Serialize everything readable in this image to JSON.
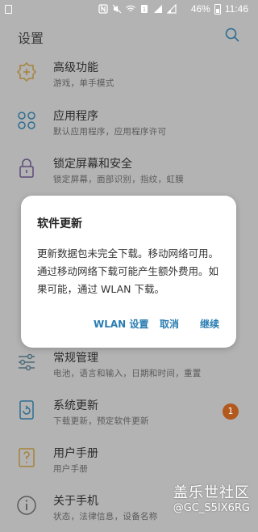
{
  "status_bar": {
    "battery_percent": "46%",
    "time": "11:46"
  },
  "header": {
    "title": "设置"
  },
  "settings_items": [
    {
      "title": "高级功能",
      "subtitle": "游戏，单手模式",
      "icon": "advanced-features-icon"
    },
    {
      "title": "应用程序",
      "subtitle": "默认应用程序，应用程序许可",
      "icon": "apps-icon"
    },
    {
      "title": "锁定屏幕和安全",
      "subtitle": "锁定屏幕，面部识别，指纹，虹膜",
      "icon": "lock-icon"
    },
    {
      "title": "常规管理",
      "subtitle": "电池，语言和输入，日期和时间，重置",
      "icon": "sliders-icon"
    },
    {
      "title": "系统更新",
      "subtitle": "下载更新，预定软件更新",
      "icon": "system-update-icon",
      "badge": "1"
    },
    {
      "title": "用户手册",
      "subtitle": "用户手册",
      "icon": "manual-icon"
    },
    {
      "title": "关于手机",
      "subtitle": "状态，法律信息，设备名称",
      "icon": "info-icon"
    }
  ],
  "dialog": {
    "title": "软件更新",
    "body": "更新数据包未完全下载。移动网络可用。通过移动网络下载可能产生额外费用。如果可能，通过 WLAN 下载。",
    "buttons": {
      "wlan_settings": "WLAN 设置",
      "cancel": "取消",
      "continue": "继续"
    }
  },
  "watermark": {
    "line1": "盖乐世社区",
    "line2": "@GC_S5IX6RG"
  },
  "colors": {
    "dimmed_background": "#b3b3b3",
    "accent": "#2a7db1",
    "badge": "#b2591e"
  }
}
